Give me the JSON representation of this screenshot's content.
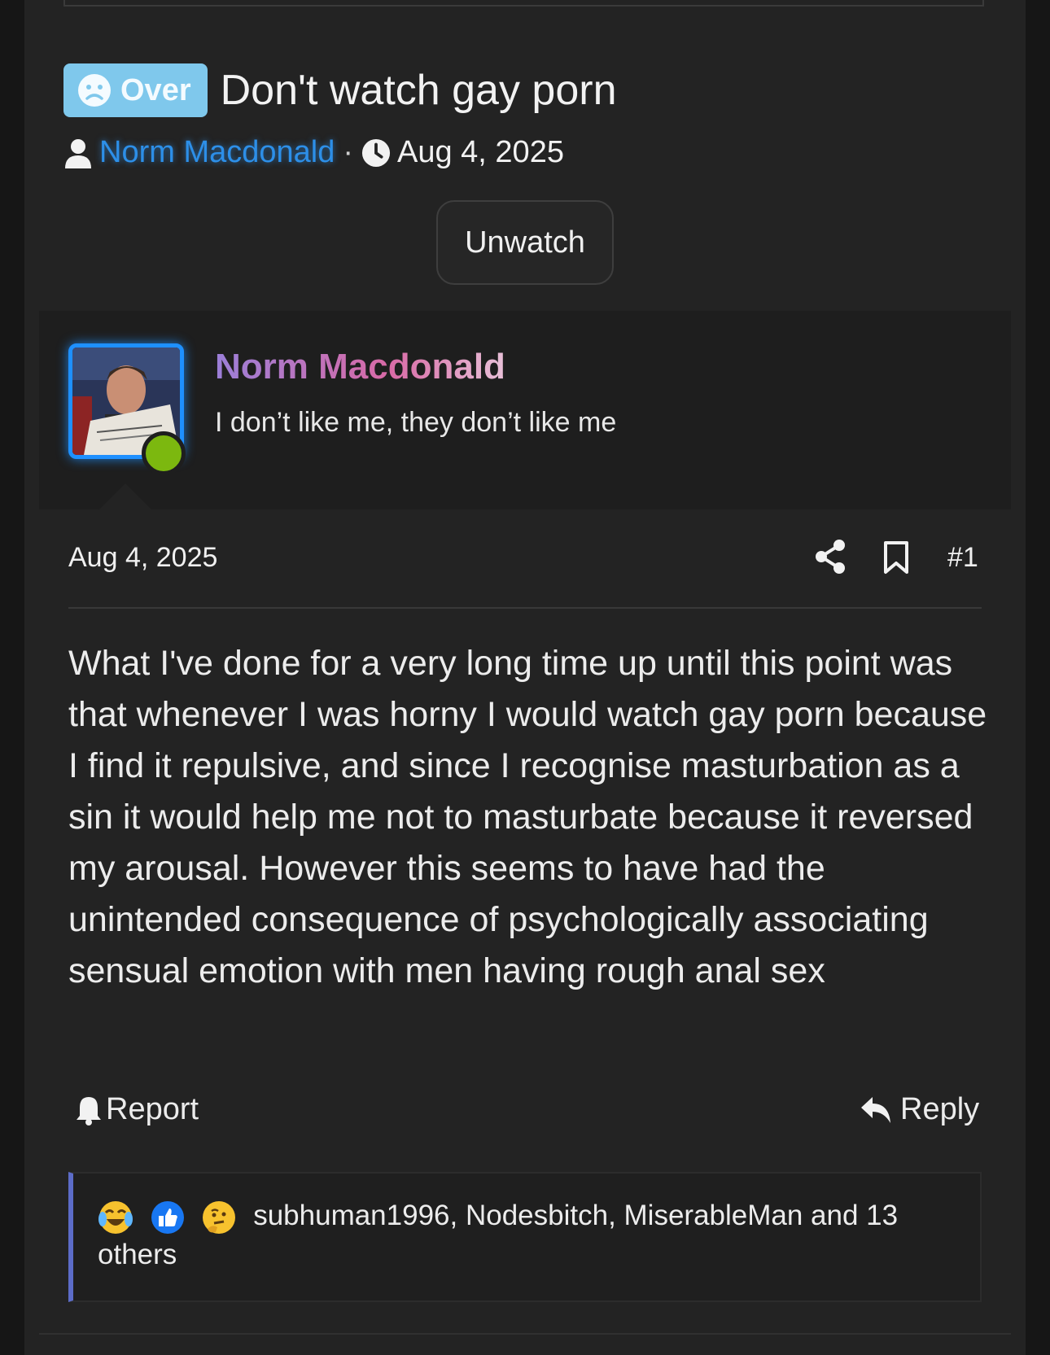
{
  "thread": {
    "prefix_label": "Over",
    "title": "Don't watch gay porn",
    "author": "Norm Macdonald",
    "separator": "·",
    "date": "Aug 4, 2025",
    "unwatch_label": "Unwatch"
  },
  "user_card": {
    "name": "Norm Macdonald",
    "tagline": "I don’t like me, they don’t like me",
    "status": "online"
  },
  "post": {
    "date": "Aug 4, 2025",
    "number": "#1",
    "body": "What I've done for a very long time up until this point was that whenever I was horny I would watch gay porn because I find it repulsive, and since I recognise masturbation as a sin it would help me not to masturbate because it reversed my arousal. However this seems to have had the unintended consequence of psychologically associating sensual emotion with men having rough anal sex",
    "report_label": "Report",
    "reply_label": "Reply"
  },
  "reactions": {
    "icons": [
      "laughing-crying-icon",
      "like-icon",
      "thinking-icon"
    ],
    "summary": "subhuman1996, Nodesbitch, MiserableMan and 13 others"
  },
  "colors": {
    "prefix_bg": "#7fc8ec",
    "author_link": "#2d8fe8",
    "avatar_border": "#1e90ff",
    "online": "#7cb80f",
    "reaction_bar": "#5c6cc8"
  }
}
